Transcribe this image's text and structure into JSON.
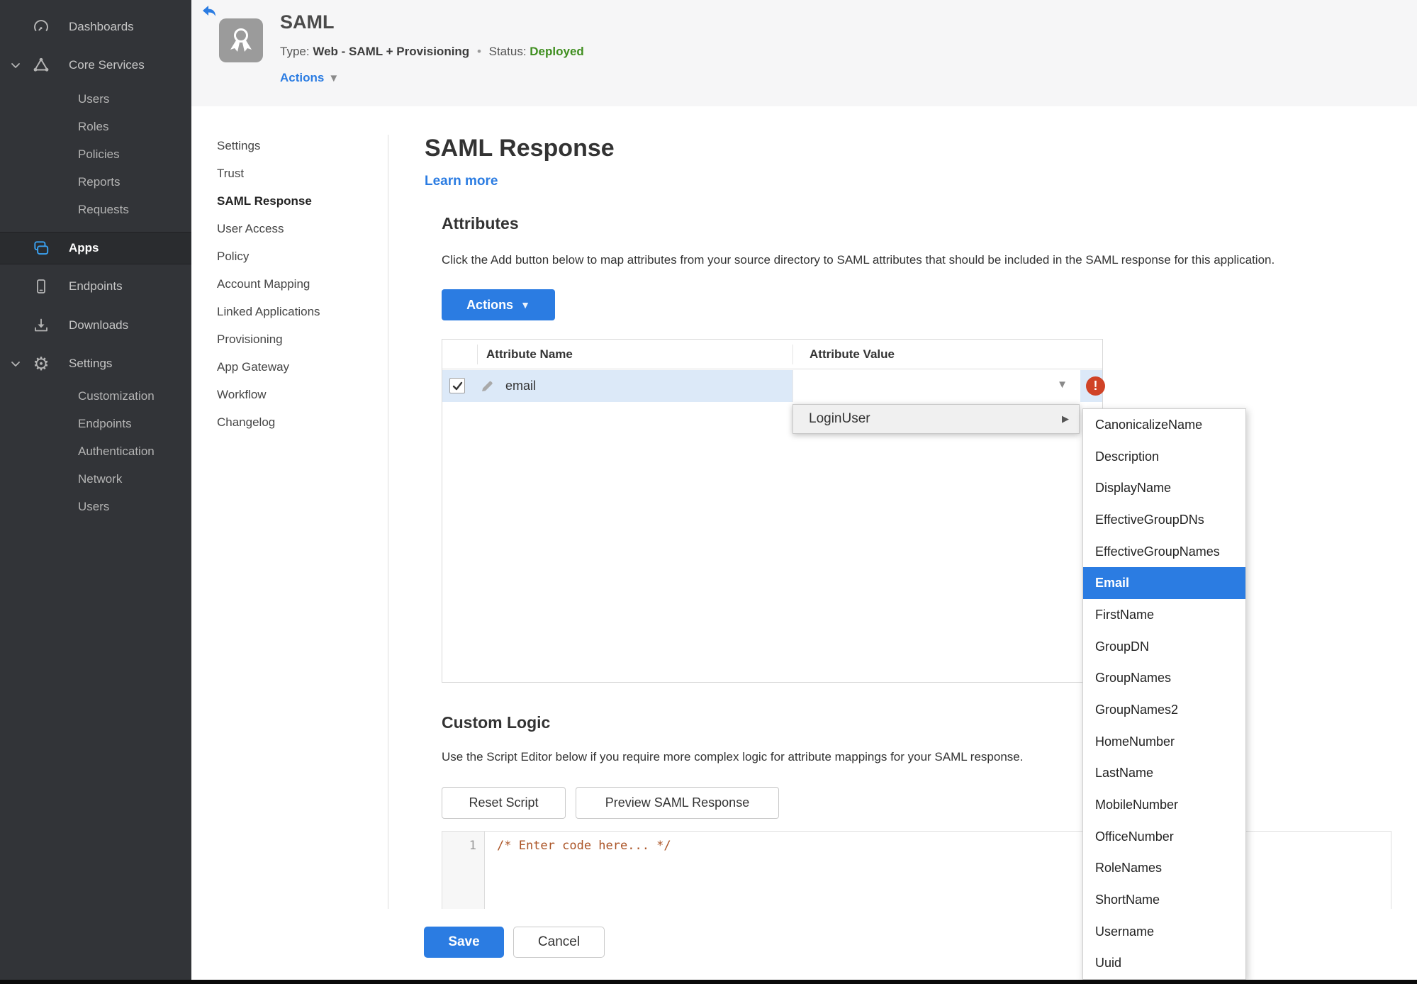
{
  "colors": {
    "accent_blue": "#2b7ce2",
    "status_green": "#3f8e1f",
    "error_red": "#d04327",
    "row_highlight": "#dce9f8",
    "sidebar_bg": "#323438"
  },
  "sidebar": {
    "dashboards": "Dashboards",
    "core_services": "Core Services",
    "core_sub": [
      "Users",
      "Roles",
      "Policies",
      "Reports",
      "Requests"
    ],
    "apps": "Apps",
    "endpoints": "Endpoints",
    "downloads": "Downloads",
    "settings": "Settings",
    "settings_sub": [
      "Customization",
      "Endpoints",
      "Authentication",
      "Network",
      "Users"
    ]
  },
  "app_header": {
    "title": "SAML",
    "type_label": "Type:",
    "type_value": "Web - SAML + Provisioning",
    "separator": "•",
    "status_label": "Status:",
    "status_value": "Deployed",
    "actions_label": "Actions"
  },
  "side_nav": {
    "items": [
      "Settings",
      "Trust",
      "SAML Response",
      "User Access",
      "Policy",
      "Account Mapping",
      "Linked Applications",
      "Provisioning",
      "App Gateway",
      "Workflow",
      "Changelog"
    ],
    "active": "SAML Response"
  },
  "main": {
    "title": "SAML Response",
    "learn_more": "Learn more",
    "attributes": {
      "heading": "Attributes",
      "description": "Click the Add button below to map attributes from your source directory to SAML attributes that should be included in the SAML response for this application.",
      "actions_button": "Actions",
      "table": {
        "col_name": "Attribute Name",
        "col_value": "Attribute Value",
        "row": {
          "name": "email",
          "value": "",
          "checked": true,
          "has_error": true
        }
      }
    },
    "value_menu": {
      "item": "LoginUser",
      "selected": "Email",
      "submenu": [
        "CanonicalizeName",
        "Description",
        "DisplayName",
        "EffectiveGroupDNs",
        "EffectiveGroupNames",
        "Email",
        "FirstName",
        "GroupDN",
        "GroupNames",
        "GroupNames2",
        "HomeNumber",
        "LastName",
        "MobileNumber",
        "OfficeNumber",
        "RoleNames",
        "ShortName",
        "Username",
        "Uuid"
      ]
    },
    "custom_logic": {
      "heading": "Custom Logic",
      "description": "Use the Script Editor below if you require more complex logic for attribute mappings for your SAML response.",
      "reset_button": "Reset Script",
      "preview_button": "Preview SAML Response",
      "editor": {
        "line_number": "1",
        "code": "/* Enter code here... */"
      }
    },
    "footer": {
      "save": "Save",
      "cancel": "Cancel"
    }
  }
}
